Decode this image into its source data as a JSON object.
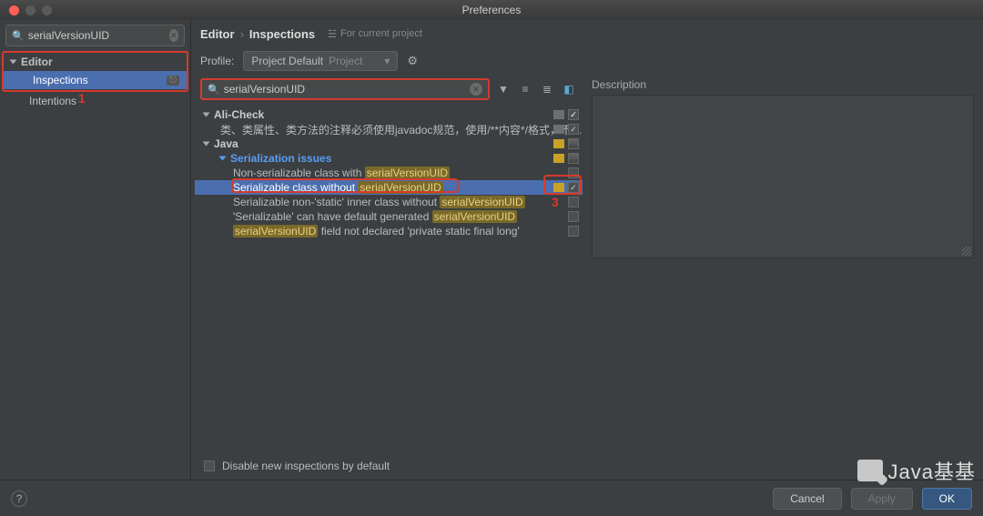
{
  "window": {
    "title": "Preferences"
  },
  "sidebar_search": {
    "value": "serialVersionUID"
  },
  "sidebar": {
    "category": "Editor",
    "items": [
      {
        "label": "Inspections",
        "selected": true,
        "badge": "⎋"
      },
      {
        "label": "Intentions",
        "selected": false
      }
    ]
  },
  "breadcrumb": {
    "a": "Editor",
    "b": "Inspections"
  },
  "current_project": "For current project",
  "profile": {
    "label": "Profile:",
    "name": "Project Default",
    "scope": "Project"
  },
  "insp_search": {
    "value": "serialVersionUID"
  },
  "tree": {
    "alicheck": {
      "label": "Ali-Check",
      "child": "类、类属性、类方法的注释必须使用javadoc规范，使用/**内容*/格式，不…"
    },
    "java": {
      "label": "Java",
      "group": "Serialization issues"
    },
    "items": [
      {
        "pre": "Non-serializable class with ",
        "hl": "serialVersionUID",
        "post": ""
      },
      {
        "pre": "Serializable class without ",
        "hl": "serialVersionUID",
        "post": "",
        "selected": true
      },
      {
        "pre": "Serializable non-'static' inner class without ",
        "hl": "serialVersionUID",
        "post": ""
      },
      {
        "pre": "'Serializable' can have default generated ",
        "hl": "serialVersionUID",
        "post": ""
      },
      {
        "pre": "",
        "hl": "serialVersionUID",
        "post": " field not declared 'private static final long'"
      }
    ]
  },
  "disable_new": "Disable new inspections by default",
  "desc": {
    "label": "Description"
  },
  "footer": {
    "cancel": "Cancel",
    "apply": "Apply",
    "ok": "OK"
  },
  "annot": {
    "num1": "1",
    "num3": "3"
  },
  "wm": "Java基基"
}
